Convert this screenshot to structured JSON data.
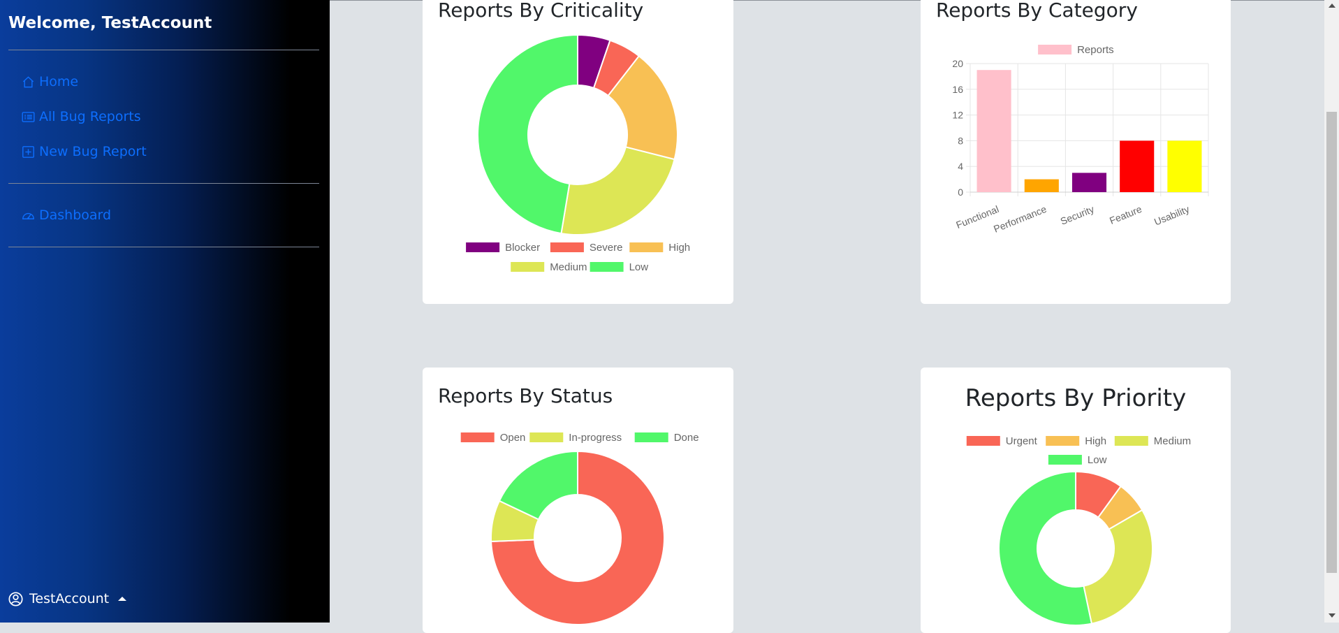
{
  "sidebar": {
    "welcome": "Welcome, TestAccount",
    "nav": [
      {
        "label": "Home",
        "icon": "house-icon"
      },
      {
        "label": "All Bug Reports",
        "icon": "list-icon"
      },
      {
        "label": "New Bug Report",
        "icon": "plus-square-icon"
      }
    ],
    "dashboard": {
      "label": "Dashboard",
      "icon": "speedometer-icon"
    },
    "user": {
      "name": "TestAccount",
      "icon": "person-circle-icon"
    }
  },
  "colors": {
    "link": "#0d6efd",
    "blocker": "#800080",
    "severe": "#f96656",
    "high": "#f8c054",
    "medium": "#dde655",
    "low": "#51f76a"
  },
  "charts": [
    {
      "id": "criticality",
      "title": "Reports By Criticality",
      "chart_data": {
        "type": "doughnut",
        "title": "Reports By Criticality",
        "labels": [
          "Blocker",
          "Severe",
          "High",
          "Medium",
          "Low"
        ],
        "values": [
          2,
          2,
          7,
          9,
          18
        ],
        "colors": [
          "#800080",
          "#f96656",
          "#f8c054",
          "#dde655",
          "#51f76a"
        ],
        "legend_position": "bottom"
      }
    },
    {
      "id": "category",
      "title": "Reports By Category",
      "chart_data": {
        "type": "bar",
        "title": "Reports By Category",
        "categories": [
          "Functional",
          "Performance",
          "Security",
          "Feature",
          "Usability"
        ],
        "series": [
          {
            "name": "Reports",
            "values": [
              19,
              2,
              3,
              8,
              8
            ]
          }
        ],
        "bar_colors": [
          "#ffc0cb",
          "#ffa500",
          "#800080",
          "#ff0000",
          "#ffff00"
        ],
        "ylim": [
          0,
          20
        ],
        "yticks": [
          0,
          4,
          8,
          12,
          16,
          20
        ],
        "grid": true,
        "legend_position": "top"
      }
    },
    {
      "id": "status",
      "title": "Reports By Status",
      "chart_data": {
        "type": "doughnut",
        "title": "Reports By Status",
        "labels": [
          "Open",
          "In-progress",
          "Done"
        ],
        "values": [
          29,
          3,
          7
        ],
        "colors": [
          "#f96656",
          "#dde655",
          "#51f76a"
        ],
        "legend_position": "top"
      }
    },
    {
      "id": "priority",
      "title": "Reports By Priority",
      "chart_data": {
        "type": "doughnut",
        "title": "Reports By Priority",
        "labels": [
          "Urgent",
          "High",
          "Medium",
          "Low"
        ],
        "values": [
          3,
          2,
          9,
          16
        ],
        "colors": [
          "#f96656",
          "#f8c054",
          "#dde655",
          "#51f76a"
        ],
        "legend_position": "top"
      }
    }
  ]
}
